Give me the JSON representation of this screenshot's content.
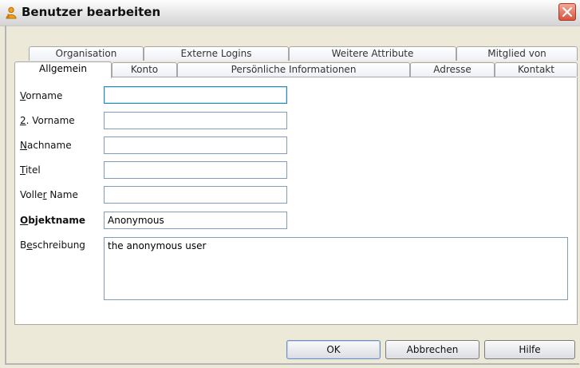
{
  "window": {
    "title": "Benutzer bearbeiten"
  },
  "tabs_row1": [
    "Organisation",
    "Externe Logins",
    "Weitere Attribute",
    "Mitglied von"
  ],
  "tabs_row2": [
    "Allgemein",
    "Konto",
    "Persönliche Informationen",
    "Adresse",
    "Kontakt"
  ],
  "active_tab": "Allgemein",
  "form": {
    "vorname": {
      "label_key": "V",
      "label_rest": "orname",
      "value": ""
    },
    "zweiter_vorname": {
      "label_key": "2",
      "label_rest": ". Vorname",
      "value": ""
    },
    "nachname": {
      "label_key": "N",
      "label_rest": "achname",
      "value": ""
    },
    "titel": {
      "label_key": "T",
      "label_rest": "itel",
      "value": ""
    },
    "voller_name": {
      "label_pre": "Volle",
      "label_key": "r",
      "label_rest": " Name",
      "value": ""
    },
    "objektname": {
      "label_key": "O",
      "label_rest": "bjektname",
      "value": "Anonymous"
    },
    "beschreibung": {
      "label_pre": "B",
      "label_key": "e",
      "label_rest": "schreibung",
      "value": "the anonymous user"
    }
  },
  "buttons": {
    "ok": "OK",
    "cancel": "Abbrechen",
    "help": "Hilfe"
  },
  "colors": {
    "close_button": "#d9533b",
    "title_icon": "#f0a01e"
  }
}
